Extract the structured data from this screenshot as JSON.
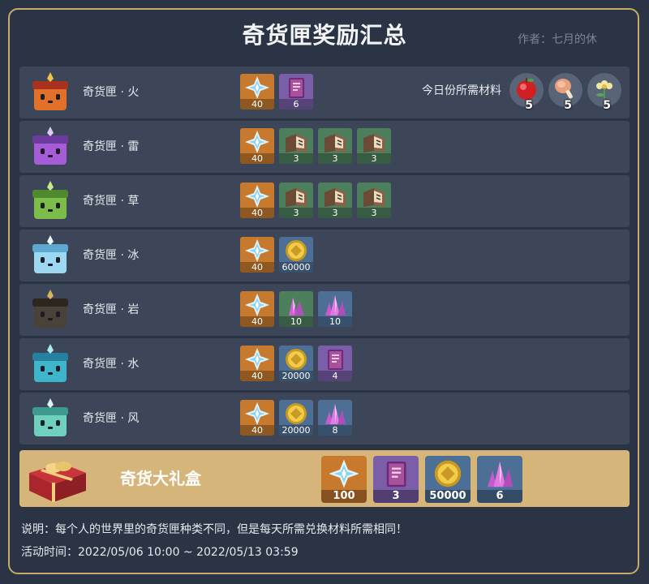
{
  "title": "奇货匣奖励汇总",
  "author": "作者：七月的休",
  "daily_materials": {
    "label": "今日份所需材料",
    "items": [
      {
        "icon": "apple-icon",
        "count": "5"
      },
      {
        "icon": "raw-meat-icon",
        "count": "5"
      },
      {
        "icon": "sweet-flower-icon",
        "count": "5"
      }
    ]
  },
  "boxes": [
    {
      "label": "奇货匣 · 火",
      "icon": "pyro-box-icon",
      "rewards": [
        {
          "icon": "primogem-icon",
          "count": "40"
        },
        {
          "icon": "heros-wit-icon",
          "count": "6"
        }
      ]
    },
    {
      "label": "奇货匣 · 雷",
      "icon": "electro-box-icon",
      "rewards": [
        {
          "icon": "primogem-icon",
          "count": "40"
        },
        {
          "icon": "talent-book-icon",
          "count": "3"
        },
        {
          "icon": "talent-book-icon",
          "count": "3"
        },
        {
          "icon": "talent-book-icon",
          "count": "3"
        }
      ]
    },
    {
      "label": "奇货匣 · 草",
      "icon": "dendro-box-icon",
      "rewards": [
        {
          "icon": "primogem-icon",
          "count": "40"
        },
        {
          "icon": "talent-book-icon",
          "count": "3"
        },
        {
          "icon": "talent-book-icon",
          "count": "3"
        },
        {
          "icon": "talent-book-icon",
          "count": "3"
        }
      ]
    },
    {
      "label": "奇货匣 · 冰",
      "icon": "cryo-box-icon",
      "rewards": [
        {
          "icon": "primogem-icon",
          "count": "40"
        },
        {
          "icon": "mora-icon",
          "count": "60000"
        }
      ]
    },
    {
      "label": "奇货匣 · 岩",
      "icon": "geo-box-icon",
      "rewards": [
        {
          "icon": "primogem-icon",
          "count": "40"
        },
        {
          "icon": "enhancement-ore-icon",
          "count": "10"
        },
        {
          "icon": "fine-ore-icon",
          "count": "10"
        }
      ]
    },
    {
      "label": "奇货匣 · 水",
      "icon": "hydro-box-icon",
      "rewards": [
        {
          "icon": "primogem-icon",
          "count": "40"
        },
        {
          "icon": "mora-icon",
          "count": "20000"
        },
        {
          "icon": "heros-wit-icon",
          "count": "4"
        }
      ]
    },
    {
      "label": "奇货匣 · 风",
      "icon": "anemo-box-icon",
      "rewards": [
        {
          "icon": "primogem-icon",
          "count": "40"
        },
        {
          "icon": "mora-icon",
          "count": "20000"
        },
        {
          "icon": "fine-ore-icon",
          "count": "8"
        }
      ]
    }
  ],
  "gift": {
    "label": "奇货大礼盒",
    "icon": "gift-box-icon",
    "rewards": [
      {
        "icon": "primogem-icon",
        "count": "100"
      },
      {
        "icon": "heros-wit-icon",
        "count": "3"
      },
      {
        "icon": "mora-icon",
        "count": "50000"
      },
      {
        "icon": "fine-ore-icon",
        "count": "6"
      }
    ]
  },
  "note": "说明：每个人的世界里的奇货匣种类不同，但是每天所需兑换材料所需相同！",
  "event_time": "活动时间：2022/05/06 10:00 ~ 2022/05/13 03:59",
  "colors": {
    "background": "#2b3444",
    "row": "#3d4658",
    "border_gold": "#c7a96e",
    "gift_bar": "#d6b57a"
  }
}
